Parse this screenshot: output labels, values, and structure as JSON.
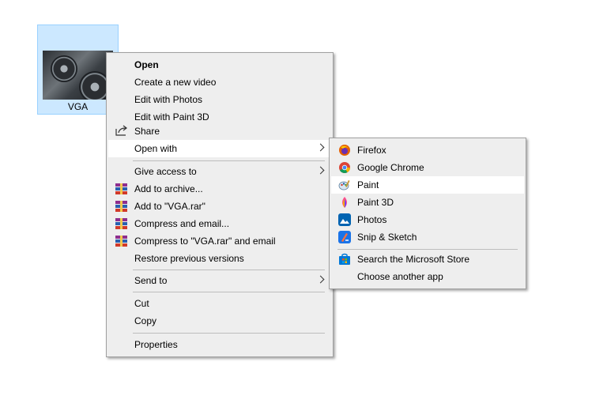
{
  "file": {
    "label": "VGA"
  },
  "context_menu": {
    "items": [
      {
        "label": "Open"
      },
      {
        "label": "Create a new video"
      },
      {
        "label": "Edit with Photos"
      },
      {
        "label": "Edit with Paint 3D"
      },
      {
        "label": "Share"
      },
      {
        "label": "Open with"
      },
      {
        "label": "Give access to"
      },
      {
        "label": "Add to archive..."
      },
      {
        "label": "Add to \"VGA.rar\""
      },
      {
        "label": "Compress and email..."
      },
      {
        "label": "Compress to \"VGA.rar\" and email"
      },
      {
        "label": "Restore previous versions"
      },
      {
        "label": "Send to"
      },
      {
        "label": "Cut"
      },
      {
        "label": "Copy"
      },
      {
        "label": "Properties"
      }
    ]
  },
  "open_with_submenu": {
    "items": [
      {
        "label": "Firefox",
        "icon": "firefox-icon"
      },
      {
        "label": "Google Chrome",
        "icon": "chrome-icon"
      },
      {
        "label": "Paint",
        "icon": "paint-icon"
      },
      {
        "label": "Paint 3D",
        "icon": "paint3d-icon"
      },
      {
        "label": "Photos",
        "icon": "photos-icon"
      },
      {
        "label": "Snip & Sketch",
        "icon": "snip-sketch-icon"
      },
      {
        "label": "Search the Microsoft Store",
        "icon": "store-icon"
      },
      {
        "label": "Choose another app"
      }
    ]
  },
  "colors": {
    "selection": "#cce8ff",
    "menu_bg": "#eeeeee",
    "hover": "#ffffff"
  }
}
